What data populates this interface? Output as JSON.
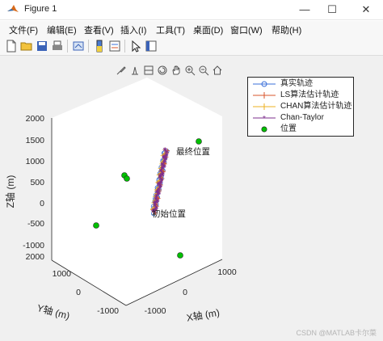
{
  "window": {
    "title": "Figure 1",
    "minimize": "—",
    "maximize": "☐",
    "close": "✕"
  },
  "menu": [
    "文件(F)",
    "编辑(E)",
    "查看(V)",
    "插入(I)",
    "工具(T)",
    "桌面(D)",
    "窗口(W)",
    "帮助(H)"
  ],
  "toolbar_icons": [
    "new-figure-icon",
    "open-file-icon",
    "save-icon",
    "print-icon",
    "link-icon",
    "colorbar-icon",
    "legend-icon",
    "select-arrow-icon",
    "property-icon"
  ],
  "axes_toolbar_icons": [
    "brush-icon",
    "data-tip-icon",
    "rotate-3d-icon",
    "pan-icon",
    "zoom-in-icon",
    "zoom-out-icon",
    "home-icon"
  ],
  "chart_data": {
    "type": "scatter",
    "title": "",
    "xlabel": "X轴 (m)",
    "ylabel": "Y轴 (m)",
    "zlabel": "Z轴 (m)",
    "x_ticks": [
      "-1000",
      "0",
      "1000"
    ],
    "y_ticks": [
      "-1000",
      "0",
      "1000",
      "2000"
    ],
    "z_ticks": [
      "-1000",
      "-500",
      "0",
      "500",
      "1000",
      "1500",
      "2000"
    ],
    "xlim": [
      -1500,
      1500
    ],
    "ylim": [
      -1500,
      2000
    ],
    "zlim": [
      -1000,
      2000
    ],
    "grid": false,
    "legend_position": "top-right",
    "colors": {
      "true_track": "#3a6fd8",
      "ls_track": "#d9542b",
      "chan_track": "#edb120",
      "chan_taylor": "#7e2f8e",
      "stations": "#00c000"
    },
    "series": [
      {
        "name": "真实轨迹",
        "marker": "circle-line"
      },
      {
        "name": "LS算法估计轨迹",
        "marker": "plus-line"
      },
      {
        "name": "CHAN算法估计轨迹",
        "marker": "plus-line"
      },
      {
        "name": "Chan-Taylor",
        "marker": "star-line"
      },
      {
        "name": "位置",
        "marker": "filled-circle"
      }
    ],
    "annotations": [
      "最终位置",
      "初始位置"
    ]
  },
  "watermark": "CSDN @MATLAB卡尔菜"
}
